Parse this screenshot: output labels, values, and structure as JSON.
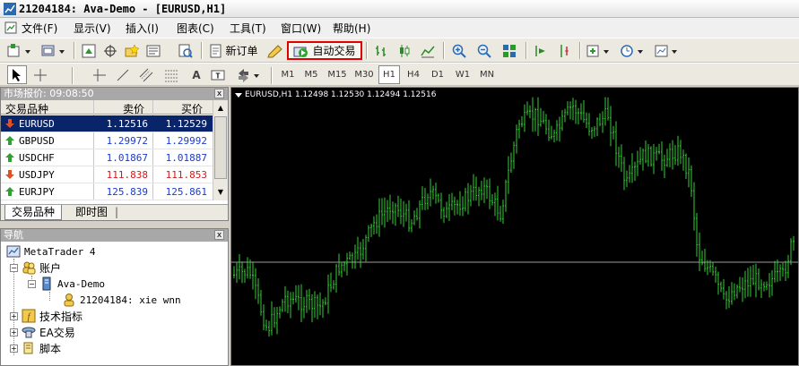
{
  "window": {
    "title": "21204184: Ava-Demo - [EURUSD,H1]"
  },
  "menu": [
    "文件(F)",
    "显示(V)",
    "插入(I)",
    "图表(C)",
    "工具(T)",
    "窗口(W)",
    "帮助(H)"
  ],
  "toolbar": {
    "new_order_label": "新订单",
    "auto_trade_label": "自动交易"
  },
  "timeframes": [
    "M1",
    "M5",
    "M15",
    "M30",
    "H1",
    "H4",
    "D1",
    "W1",
    "MN"
  ],
  "active_timeframe": "H1",
  "market_watch": {
    "header": "市场报价: 09:08:50",
    "columns": {
      "symbol": "交易品种",
      "bid": "卖价",
      "ask": "买价"
    },
    "rows": [
      {
        "symbol": "EURUSD",
        "bid": "1.12516",
        "ask": "1.12529",
        "direction": "down"
      },
      {
        "symbol": "GBPUSD",
        "bid": "1.29972",
        "ask": "1.29992",
        "direction": "up"
      },
      {
        "symbol": "USDCHF",
        "bid": "1.01867",
        "ask": "1.01887",
        "direction": "up"
      },
      {
        "symbol": "USDJPY",
        "bid": "111.838",
        "ask": "111.853",
        "direction": "down"
      },
      {
        "symbol": "EURJPY",
        "bid": "125.839",
        "ask": "125.861",
        "direction": "up"
      }
    ],
    "tabs": [
      "交易品种",
      "即时图"
    ]
  },
  "navigator": {
    "header": "导航",
    "root": "MetaTrader 4",
    "accounts": "账户",
    "server": "Ava-Demo",
    "account": "21204184: xie wnn",
    "indicators": "技术指标",
    "experts": "EA交易",
    "scripts": "脚本"
  },
  "chart": {
    "info": "EURUSD,H1  1.12498 1.12530 1.12494 1.12516",
    "colors": {
      "background": "#000000",
      "bar": "#33cc33",
      "price_line": "#9c9c9c"
    }
  }
}
